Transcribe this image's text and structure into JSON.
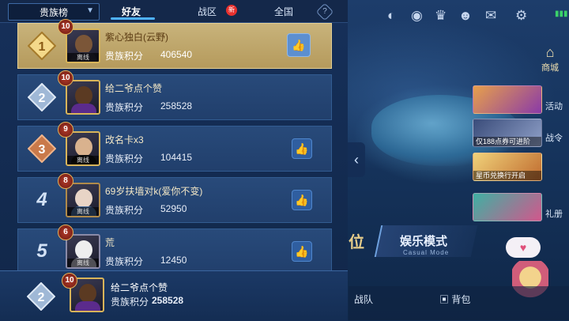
{
  "tabs": {
    "dropdown": "贵族榜",
    "friends": "好友",
    "region": "战区",
    "global": "全国",
    "new_badge": "新",
    "help": "?"
  },
  "rows": [
    {
      "rank": "1",
      "level": "10",
      "name": "紫心独白(云野)",
      "score_label": "贵族积分",
      "score": "406540",
      "status": "离线"
    },
    {
      "rank": "2",
      "level": "10",
      "name": "给二爷点个赞",
      "score_label": "贵族积分",
      "score": "258528",
      "status": ""
    },
    {
      "rank": "3",
      "level": "9",
      "name": "改名卡x3",
      "score_label": "贵族积分",
      "score": "104415",
      "status": "离线"
    },
    {
      "rank": "4",
      "level": "8",
      "name": "69岁扶墙对k(爱你不变)",
      "score_label": "贵族积分",
      "score": "52950",
      "status": "离线"
    },
    {
      "rank": "5",
      "level": "6",
      "name": "荒",
      "score_label": "贵族积分",
      "score": "12450",
      "status": "离线"
    }
  ],
  "me": {
    "rank": "2",
    "level": "10",
    "name": "给二爷点个赞",
    "score_label": "贵族积分",
    "score": "258528"
  },
  "right": {
    "mall": "商城",
    "tasks": "战令",
    "ad1_caption": "仅188点券可进阶",
    "ad2_caption": "星币兑换行开启",
    "ad1_label": "活动",
    "ad3_label": "礼册",
    "mode_title": "娱乐模式",
    "mode_sub": "Casual Mode",
    "rank_mode": "位",
    "team": "战队",
    "bag": "背包"
  },
  "icons": [
    "friends-icon",
    "eye-icon",
    "trophy-icon",
    "group-icon",
    "mail-icon",
    "gear-icon"
  ]
}
